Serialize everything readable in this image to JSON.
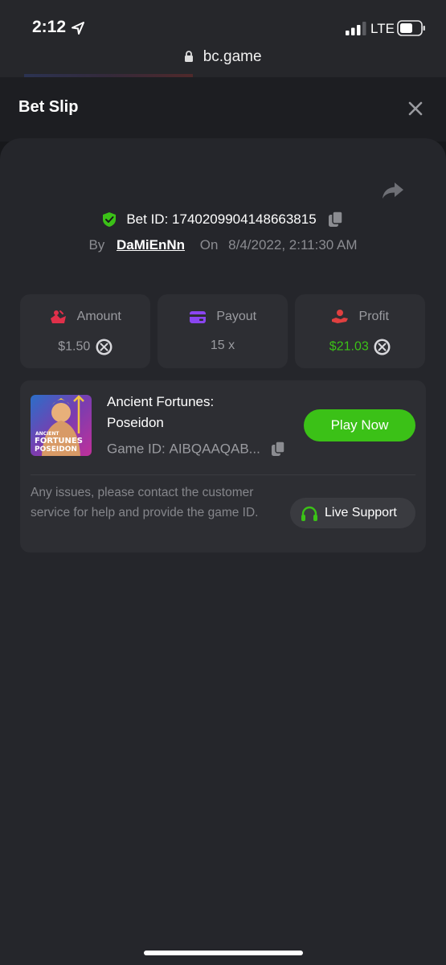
{
  "status_bar": {
    "time": "2:12",
    "network": "LTE"
  },
  "browser": {
    "url": "bc.game"
  },
  "modal": {
    "title": "Bet Slip",
    "bet_id_label": "Bet ID:",
    "bet_id": "1740209904148663815",
    "by_label": "By",
    "username": "DaMiEnNn",
    "on_label": "On",
    "datetime": "8/4/2022, 2:11:30 AM"
  },
  "stats": {
    "amount": {
      "label": "Amount",
      "value": "$1.50"
    },
    "payout": {
      "label": "Payout",
      "value": "15 x"
    },
    "profit": {
      "label": "Profit",
      "value": "$21.03"
    }
  },
  "game": {
    "name": "Ancient Fortunes: Poseidon",
    "id_label": "Game ID:",
    "id_value": "AIBQAAQAB...",
    "thumb_text": {
      "line1": "ANCIENT",
      "line2": "FORTUNES",
      "line3": "POSEIDON"
    },
    "play_label": "Play Now"
  },
  "support": {
    "help_text": "Any issues, please contact the customer service for help and provide the game ID.",
    "button_label": "Live Support"
  },
  "colors": {
    "accent_green": "#3bc117",
    "amount_icon": "#e0304a",
    "payout_icon": "#8a45f0",
    "profit_icon": "#e04040"
  }
}
